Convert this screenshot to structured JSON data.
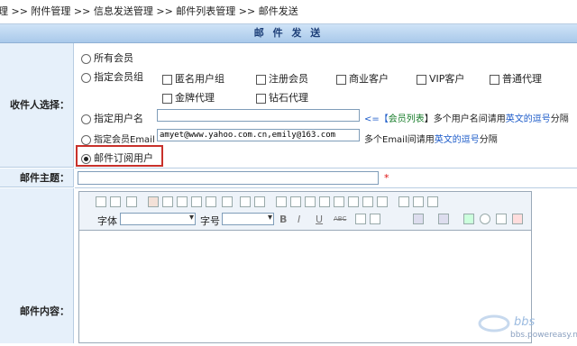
{
  "breadcrumb": {
    "text": "理 >> 附件管理 >> 信息发送管理 >> 邮件列表管理 >> 邮件发送"
  },
  "header": {
    "title": "邮 件 发 送"
  },
  "recipient": {
    "label": "收件人选择：",
    "all_members": "所有会员",
    "member_groups": "指定会员组",
    "groups": [
      "匿名用户组",
      "注册会员",
      "商业客户",
      "VIP客户",
      "普通代理",
      "金牌代理",
      "钻石代理"
    ],
    "usernames_label": "指定用户名",
    "usernames_value": "",
    "usernames_hint_pre": "<=【",
    "usernames_hint_link": "会员列表",
    "usernames_hint_mid": "】多个用户名间请用",
    "usernames_hint_comma": "英文的逗号",
    "usernames_hint_post": "分隔",
    "emails_label": "指定会员Email",
    "emails_value": "amyet@www.yahoo.com.cn,emily@163.com",
    "emails_hint_pre": "多个Email间请用",
    "emails_hint_comma": "英文的逗号",
    "emails_hint_post": "分隔",
    "subscribers_label": "邮件订阅用户"
  },
  "subject": {
    "label": "邮件主题：",
    "value": "",
    "required_mark": "*"
  },
  "content": {
    "label": "邮件内容：",
    "font_label": "字体",
    "size_label": "字号",
    "bold": "B",
    "italic": "I",
    "underline": "U",
    "strike": "ABC"
  },
  "watermark": {
    "site": "bbs.powereasy.net"
  }
}
